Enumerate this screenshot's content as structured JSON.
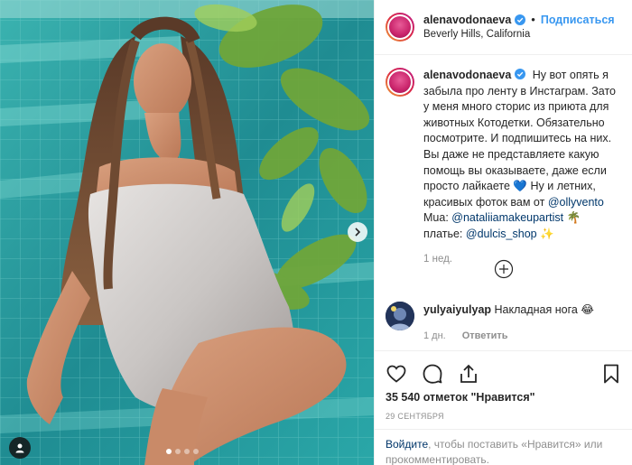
{
  "post": {
    "username": "alenavodonaeva",
    "follow_label": "Подписаться",
    "separator": "•",
    "location": "Beverly Hills, California"
  },
  "caption": {
    "username": "alenavodonaeva",
    "text_1": "Ну вот опять я забыла про ленту в Инстаграм. Зато у меня много сторис из приюта для животных Котодетки. Обязательно посмотрите. И подпишитесь на них. Вы даже не представляете какую помощь вы оказываете, даже если просто лайкаете",
    "heart_emoji": "💙",
    "text_2": "Ну и летних, красивых фоток вам от",
    "mention_1": "@ollyvento",
    "text_3": "Mua:",
    "mention_2": "@nataliiamakeupartist",
    "palm_emoji": "🌴",
    "text_4": "платье:",
    "mention_3": "@dulcis_shop",
    "sparkle_emoji": "✨",
    "time": "1 нед."
  },
  "comment": {
    "username": "yulyaiyulyap",
    "text": "Накладная нога",
    "emoji": "😂",
    "time": "1 дн.",
    "reply_label": "Ответить"
  },
  "stats": {
    "likes": "35 540 отметок \"Нравится\"",
    "date": "29 СЕНТЯБРЯ"
  },
  "login": {
    "link": "Войдите",
    "text": ", чтобы поставить «Нравится» или прокомментировать."
  },
  "carousel": {
    "count": 4,
    "active_index": 0
  },
  "colors": {
    "accent": "#3897f0",
    "mention": "#00376b",
    "muted": "#8e8e8e",
    "pool_tile": "#2a9a9d"
  }
}
